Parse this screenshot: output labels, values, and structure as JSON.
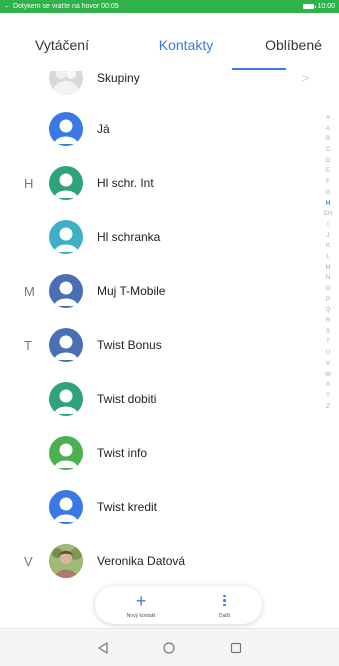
{
  "status_bar": {
    "text": "← Dotykem se vraťte na hovor 00:05",
    "time": "10:00",
    "color": "#2fb24a"
  },
  "tabs": [
    {
      "label": "Vytáčení"
    },
    {
      "label": "Kontakty",
      "active": true
    },
    {
      "label": "Oblíbené"
    }
  ],
  "accent_color": "#3b78e7",
  "contacts": [
    {
      "letter": "",
      "name": "Skupiny",
      "avatar": "group-avatar-icon",
      "chevron": ">"
    },
    {
      "letter": "",
      "name": "Já",
      "avatar": "person-avatar-icon",
      "color": "#3b78e7"
    },
    {
      "letter": "H",
      "name": "Hl schr. Int",
      "avatar": "person-avatar-icon",
      "color": "#2ea37c"
    },
    {
      "letter": "",
      "name": "Hl schranka",
      "avatar": "person-avatar-icon",
      "color": "#3db0c4"
    },
    {
      "letter": "M",
      "name": "Muj T-Mobile",
      "avatar": "person-avatar-icon",
      "color": "#4a6fb5"
    },
    {
      "letter": "T",
      "name": "Twist Bonus",
      "avatar": "person-avatar-icon",
      "color": "#4a6fb5"
    },
    {
      "letter": "",
      "name": "Twist dobiti",
      "avatar": "person-avatar-icon",
      "color": "#2ea37c"
    },
    {
      "letter": "",
      "name": "Twist info",
      "avatar": "person-avatar-icon",
      "color": "#4caf50"
    },
    {
      "letter": "",
      "name": "Twist kredit",
      "avatar": "person-avatar-icon",
      "color": "#3b78e7"
    },
    {
      "letter": "V",
      "name": "Veronika Datová",
      "avatar": "photo-avatar",
      "color": "#b07a6a"
    }
  ],
  "alphabet_index": [
    "#",
    "A",
    "B",
    "C",
    "D",
    "E",
    "F",
    "G",
    "H",
    "CH",
    "I",
    "J",
    "K",
    "L",
    "M",
    "N",
    "O",
    "P",
    "Q",
    "R",
    "S",
    "T",
    "U",
    "V",
    "W",
    "X",
    "Y",
    "Z"
  ],
  "alphabet_active": "H",
  "bottom_actions": {
    "add_label": "Nový kontakt",
    "more_label": "Další"
  },
  "navigation": [
    "back-icon",
    "home-icon",
    "recents-icon"
  ]
}
